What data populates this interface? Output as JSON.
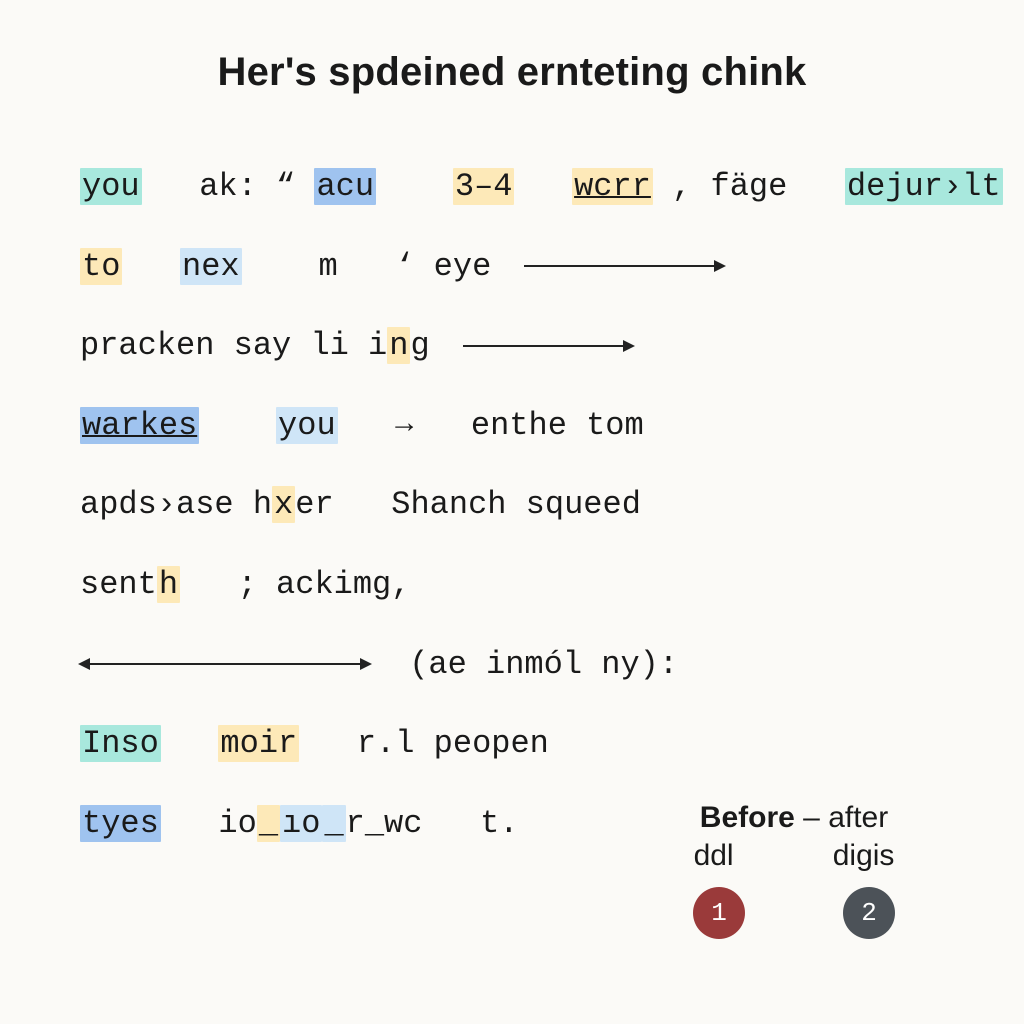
{
  "title": "Her's spdeined ernteting chink",
  "lines": {
    "l1": {
      "w1": "you",
      "w2": "ak:",
      "q1": "“",
      "w3": "acu",
      "w4": "3–4",
      "w5": "wcrr",
      "w6": ", fäge",
      "w7": "dejur›lt",
      "q2": "”"
    },
    "l2": {
      "w1": "to",
      "w2": "nex",
      "w3": "m",
      "w4": "‘",
      "w5": "eye"
    },
    "l3": {
      "w1": "pracken say li i",
      "w2": "n",
      "w3": "g"
    },
    "l4": {
      "w1": "warkes",
      "w2": "you",
      "arrow": "→",
      "w3": "enthe tom"
    },
    "l5": {
      "w1": "apds›ase h",
      "w2": "x",
      "w3": "er",
      "w4": "Shanch squeed"
    },
    "l6": {
      "w1": "sent",
      "w2": "h",
      "w3": ";",
      "w4": "ackimg,"
    },
    "l7": {
      "paren": "(ae inmól ny):"
    },
    "l8": {
      "w1": "Inso",
      "w2": "moir",
      "w3": "r.l peopen"
    },
    "l9": {
      "w1": "tyes",
      "w2": "io",
      "u1": "_",
      "w3": "ıo",
      "u2": "_",
      "w4": "r",
      "u3": "_",
      "w5": "wc",
      "w6": "t."
    }
  },
  "legend": {
    "before": "Before",
    "dash": "–",
    "after": "after",
    "left": "ddl",
    "right": "digis",
    "dot1": "1",
    "dot2": "2"
  }
}
